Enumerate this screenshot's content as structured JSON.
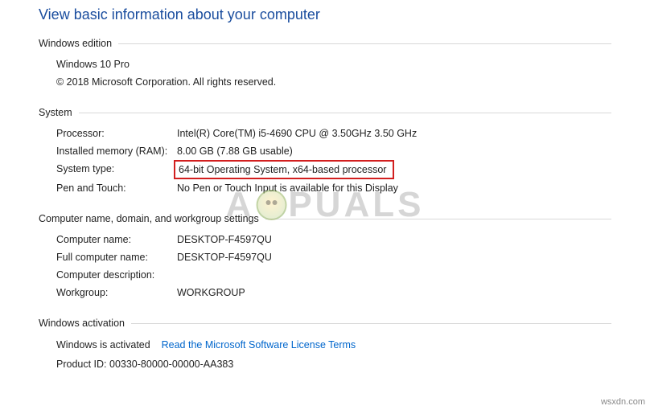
{
  "title": "View basic information about your computer",
  "edition": {
    "heading": "Windows edition",
    "name": "Windows 10 Pro",
    "copyright": "© 2018 Microsoft Corporation. All rights reserved."
  },
  "system": {
    "heading": "System",
    "processor_label": "Processor:",
    "processor_value": "Intel(R) Core(TM) i5-4690 CPU @ 3.50GHz   3.50 GHz",
    "ram_label": "Installed memory (RAM):",
    "ram_value": "8.00 GB (7.88 GB usable)",
    "systype_label": "System type:",
    "systype_value": "64-bit Operating System, x64-based processor",
    "pentouch_label": "Pen and Touch:",
    "pentouch_value": "No Pen or Touch Input is available for this Display"
  },
  "computer": {
    "heading": "Computer name, domain, and workgroup settings",
    "name_label": "Computer name:",
    "name_value": "DESKTOP-F4597QU",
    "fullname_label": "Full computer name:",
    "fullname_value": "DESKTOP-F4597QU",
    "desc_label": "Computer description:",
    "desc_value": "",
    "workgroup_label": "Workgroup:",
    "workgroup_value": "WORKGROUP"
  },
  "activation": {
    "heading": "Windows activation",
    "status": "Windows is activated",
    "link_text": "Read the Microsoft Software License Terms",
    "product_id": "Product ID: 00330-80000-00000-AA383"
  },
  "watermark": {
    "left": "A",
    "right": "PUALS"
  },
  "credit": "wsxdn.com"
}
